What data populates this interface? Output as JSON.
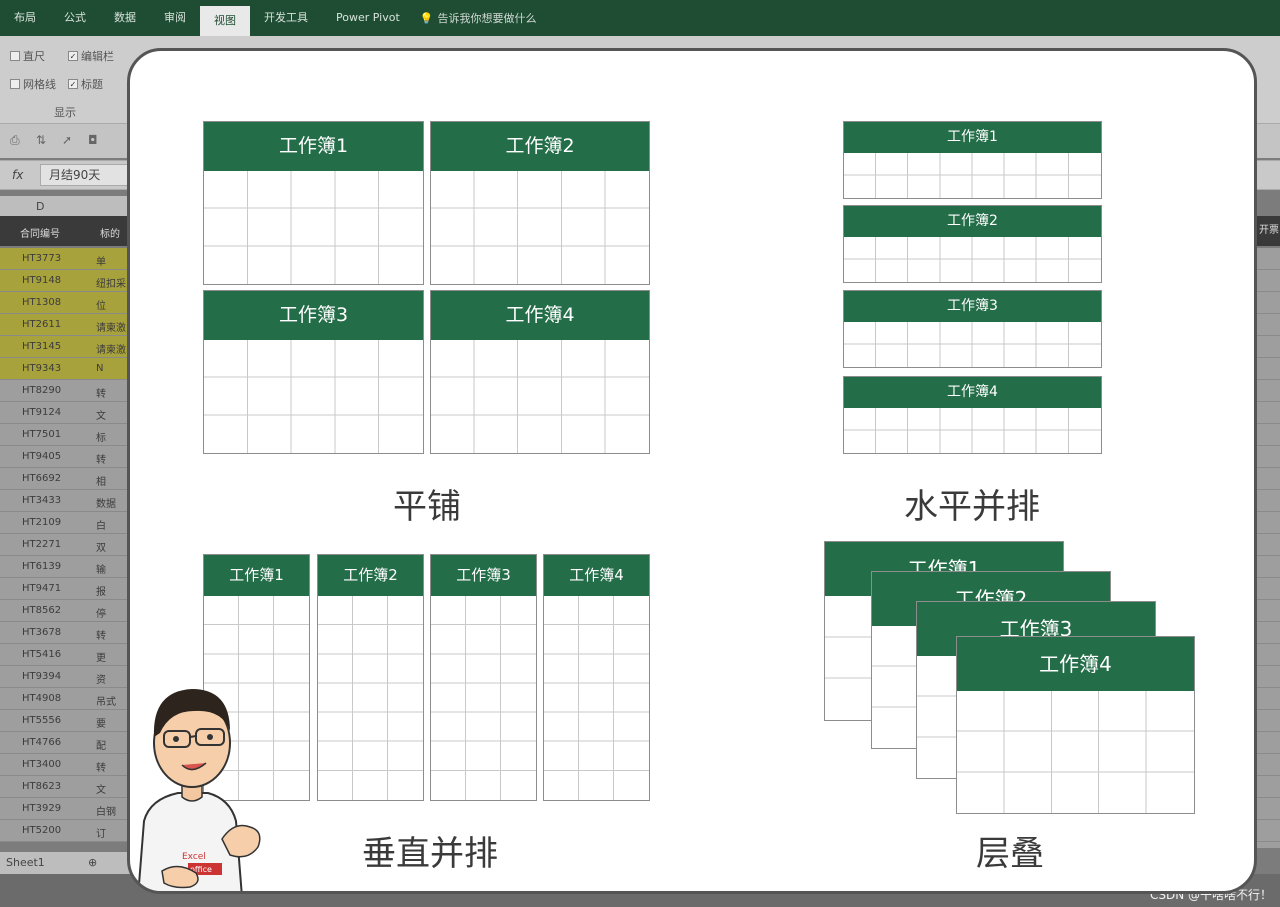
{
  "ribbon": {
    "tabs": [
      "布局",
      "公式",
      "数据",
      "审阅",
      "视图",
      "开发工具",
      "Power Pivot"
    ],
    "active_tab": "视图",
    "tell_me": "告诉我你想要做什么",
    "show_group": {
      "ruler": "直尺",
      "formula_bar": "编辑栏",
      "gridlines": "网格线",
      "headings": "标题",
      "label": "显示"
    }
  },
  "formula_bar": {
    "fx": "fx",
    "value": "月结90天"
  },
  "sheet": {
    "column": "D",
    "headers": [
      "合同编号",
      "标的"
    ],
    "right_header": "开票",
    "rows": [
      {
        "id": "HT3773",
        "t": "单",
        "hl": true
      },
      {
        "id": "HT9148",
        "t": "纽扣采",
        "hl": true
      },
      {
        "id": "HT1308",
        "t": "位",
        "hl": true
      },
      {
        "id": "HT2611",
        "t": "请柬激",
        "hl": true
      },
      {
        "id": "HT3145",
        "t": "请柬激",
        "hl": true
      },
      {
        "id": "HT9343",
        "t": "N",
        "hl": true
      },
      {
        "id": "HT8290",
        "t": "转",
        "hl": false
      },
      {
        "id": "HT9124",
        "t": "文",
        "hl": false
      },
      {
        "id": "HT7501",
        "t": "标",
        "hl": false
      },
      {
        "id": "HT9405",
        "t": "转",
        "hl": false
      },
      {
        "id": "HT6692",
        "t": "相",
        "hl": false
      },
      {
        "id": "HT3433",
        "t": "数据",
        "hl": false
      },
      {
        "id": "HT2109",
        "t": "白",
        "hl": false
      },
      {
        "id": "HT2271",
        "t": "双",
        "hl": false
      },
      {
        "id": "HT6139",
        "t": "输",
        "hl": false
      },
      {
        "id": "HT9471",
        "t": "报",
        "hl": false
      },
      {
        "id": "HT8562",
        "t": "停",
        "hl": false
      },
      {
        "id": "HT3678",
        "t": "转",
        "hl": false
      },
      {
        "id": "HT5416",
        "t": "更",
        "hl": false
      },
      {
        "id": "HT9394",
        "t": "资",
        "hl": false
      },
      {
        "id": "HT4908",
        "t": "吊式",
        "hl": false
      },
      {
        "id": "HT5556",
        "t": "要",
        "hl": false
      },
      {
        "id": "HT4766",
        "t": "配",
        "hl": false
      },
      {
        "id": "HT3400",
        "t": "转",
        "hl": false
      },
      {
        "id": "HT8623",
        "t": "文",
        "hl": false
      },
      {
        "id": "HT3929",
        "t": "白钢",
        "hl": false
      },
      {
        "id": "HT5200",
        "t": "订",
        "hl": false
      }
    ],
    "sheet_tab": "Sheet1",
    "add_sheet": "⊕"
  },
  "slide": {
    "arrangements": {
      "tiled": {
        "caption": "平铺",
        "books": [
          "工作簿1",
          "工作簿2",
          "工作簿3",
          "工作簿4"
        ]
      },
      "horizontal": {
        "caption": "水平并排",
        "books": [
          "工作簿1",
          "工作簿2",
          "工作簿3",
          "工作簿4"
        ]
      },
      "vertical": {
        "caption": "垂直并排",
        "books": [
          "工作簿1",
          "工作簿2",
          "工作簿3",
          "工作簿4"
        ]
      },
      "cascade": {
        "caption": "层叠",
        "books": [
          "工作簿1",
          "工作簿2",
          "工作簿3",
          "工作簿4"
        ]
      }
    },
    "character_shirt_text": [
      "Excel",
      "office"
    ]
  },
  "watermark": "CSDN @干啥啥不行！",
  "colors": {
    "header_green": "#236d48",
    "ribbon_green": "#1f4d33",
    "highlight_yellow": "#a8a23c"
  }
}
